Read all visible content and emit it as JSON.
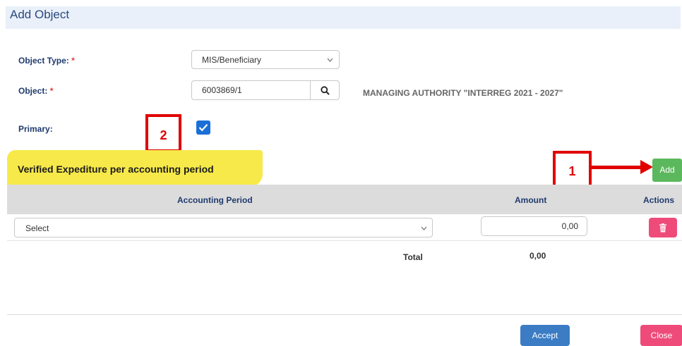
{
  "dialog": {
    "title": "Add Object"
  },
  "form": {
    "object_type": {
      "label": "Object Type:",
      "required_mark": "*",
      "value": "MIS/Beneficiary"
    },
    "object": {
      "label": "Object:",
      "required_mark": "*",
      "value": "6003869/1",
      "description": "MANAGING AUTHORITY \"INTERREG 2021 - 2027\""
    },
    "primary": {
      "label": "Primary:",
      "checked": true
    }
  },
  "annotations": {
    "marker_1": "1",
    "marker_2": "2",
    "color": "#e00000"
  },
  "section": {
    "title": "Verified Expediture per accounting period",
    "highlight_color": "#f7e94a",
    "add_label": "Add"
  },
  "table": {
    "columns": {
      "period": "Accounting Period",
      "amount": "Amount",
      "actions": "Actions"
    },
    "rows": [
      {
        "period": "Select",
        "amount": "0,00"
      }
    ],
    "total_label": "Total",
    "total_value": "0,00"
  },
  "footer": {
    "accept_label": "Accept",
    "close_label": "Close"
  },
  "colors": {
    "accent": "#1f3a6e",
    "add_green": "#5cb85c",
    "accept_blue": "#3b7cc4",
    "danger_pink": "#ef4b7a"
  }
}
